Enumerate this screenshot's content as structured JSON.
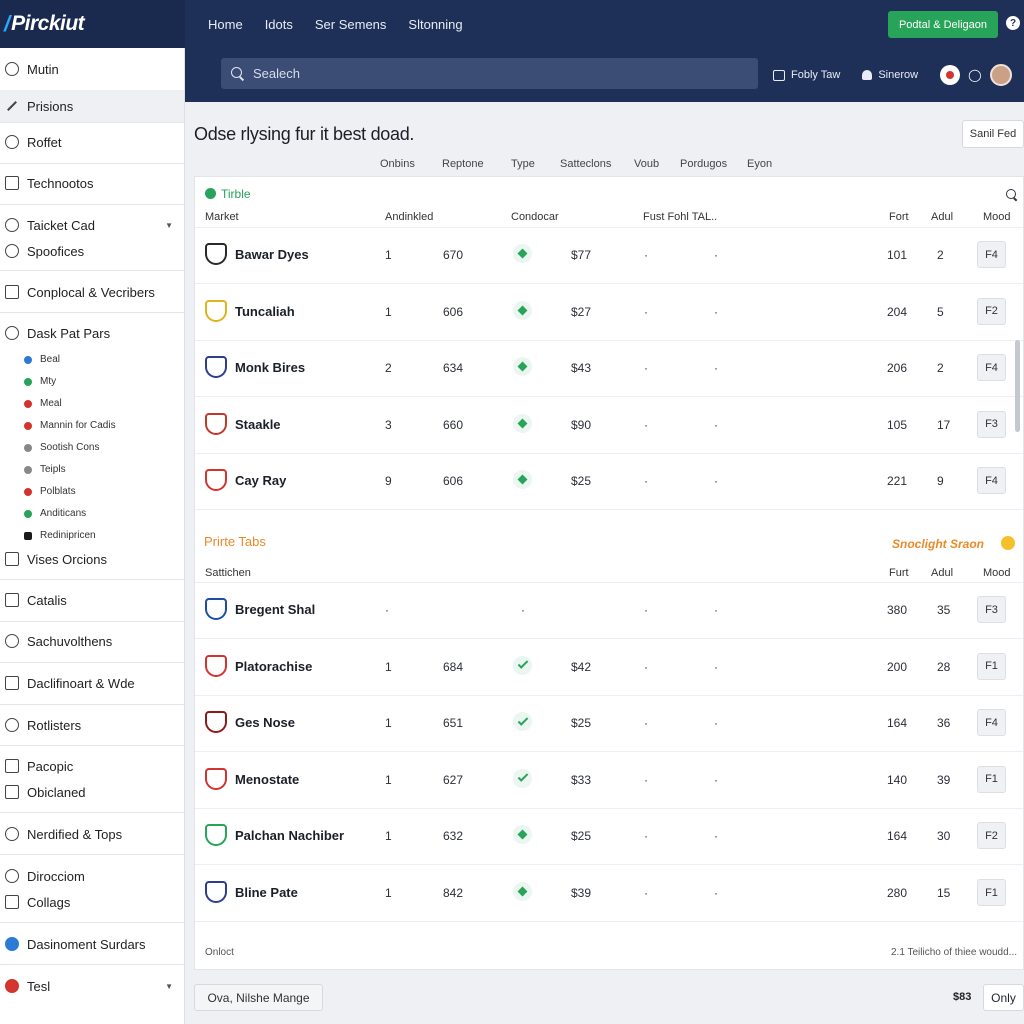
{
  "app": {
    "logo_mark": "/",
    "logo_text": "Pirckiut"
  },
  "topnav": [
    "Home",
    "Idots",
    "Ser Semens",
    "Sltonning"
  ],
  "cta_label": "Podtal & Deligaon",
  "help_glyph": "?",
  "search": {
    "placeholder": "Sealech"
  },
  "subbar": {
    "link1": "Fobly Taw",
    "link2": "Sinerow"
  },
  "sidebar": {
    "items": [
      "Mutin",
      "Prisions",
      "Roffet",
      "Technootos",
      "Taicket Cad",
      "Spoofices",
      "Conplocal & Vecribers",
      "Dask Pat Pars",
      "Vises Orcions",
      "Catalis",
      "Sachuvolthens",
      "Daclifinoart & Wde",
      "Rotlisters",
      "Pacopic",
      "Obiclaned",
      "Nerdified & Tops",
      "Dirocciom",
      "Collags",
      "Dasinoment Surdars",
      "Tesl"
    ],
    "subitems": [
      "Beal",
      "Mty",
      "Meal",
      "Mannin for Cadis",
      "Sootish Cons",
      "Teipls",
      "Polblats",
      "Anditicans",
      "Redinipricen"
    ],
    "sub_colors": [
      "#2a7bd6",
      "#27a35a",
      "#d2342f",
      "#d2342f",
      "#888888",
      "#888888",
      "#d2342f",
      "#27a35a",
      "#1a1a1a"
    ]
  },
  "main": {
    "title": "Odse rlysing fur it best doad.",
    "sort_label": "Sanil Fed",
    "filters": [
      "Onbins",
      "Reptone",
      "Type",
      "Satteclons",
      "Voub",
      "Pordugos",
      "Eyon"
    ]
  },
  "section1": {
    "title": "Tirble",
    "columns": [
      "Market",
      "Andinkled",
      "Condocar",
      "Fust Fohl TAL..",
      "Fort",
      "Adul",
      "Mood"
    ],
    "rows": [
      {
        "name": "Bawar Dyes",
        "a": "1",
        "b": "670",
        "status": "diamond",
        "price": "$77",
        "d1": "·",
        "d2": "·",
        "fort": "101",
        "adul": "2",
        "mood": "F4",
        "logo": "#2a2a2a"
      },
      {
        "name": "Tuncaliah",
        "a": "1",
        "b": "606",
        "status": "diamond",
        "price": "$27",
        "d1": "·",
        "d2": "·",
        "fort": "204",
        "adul": "5",
        "mood": "F2",
        "logo": "#e0b41e"
      },
      {
        "name": "Monk Bires",
        "a": "2",
        "b": "634",
        "status": "diamond",
        "price": "$43",
        "d1": "·",
        "d2": "·",
        "fort": "206",
        "adul": "2",
        "mood": "F4",
        "logo": "#2d3e8c"
      },
      {
        "name": "Staakle",
        "a": "3",
        "b": "660",
        "status": "diamond",
        "price": "$90",
        "d1": "·",
        "d2": "·",
        "fort": "105",
        "adul": "17",
        "mood": "F3",
        "logo": "#c0392b"
      },
      {
        "name": "Cay Ray",
        "a": "9",
        "b": "606",
        "status": "diamond",
        "price": "$25",
        "d1": "·",
        "d2": "·",
        "fort": "221",
        "adul": "9",
        "mood": "F4",
        "logo": "#d2342f"
      }
    ]
  },
  "section2": {
    "title": "Prirte Tabs",
    "spotlight": "Snoclight Sraon",
    "columns": [
      "Sattichen",
      "Furt",
      "Adul",
      "Mood"
    ],
    "rows": [
      {
        "name": "Bregent Shal",
        "a": "·",
        "b": "",
        "status": "none",
        "mid": "·",
        "price": "",
        "d1": "·",
        "d2": "·",
        "fort": "380",
        "adul": "35",
        "mood": "F3",
        "logo": "#1f4fa3"
      },
      {
        "name": "Platorachise",
        "a": "1",
        "b": "684",
        "status": "check",
        "price": "$42",
        "d1": "·",
        "d2": "·",
        "fort": "200",
        "adul": "28",
        "mood": "F1",
        "logo": "#d2342f"
      },
      {
        "name": "Ges Nose",
        "a": "1",
        "b": "651",
        "status": "check",
        "price": "$25",
        "d1": "·",
        "d2": "·",
        "fort": "164",
        "adul": "36",
        "mood": "F4",
        "logo": "#8e1b1b"
      },
      {
        "name": "Menostate",
        "a": "1",
        "b": "627",
        "status": "check",
        "price": "$33",
        "d1": "·",
        "d2": "·",
        "fort": "140",
        "adul": "39",
        "mood": "F1",
        "logo": "#d2342f"
      },
      {
        "name": "Palchan Nachiber",
        "a": "1",
        "b": "632",
        "status": "diamond",
        "price": "$25",
        "d1": "·",
        "d2": "·",
        "fort": "164",
        "adul": "30",
        "mood": "F2",
        "logo": "#27a35a"
      },
      {
        "name": "Bline Pate",
        "a": "1",
        "b": "842",
        "status": "diamond",
        "price": "$39",
        "d1": "·",
        "d2": "·",
        "fort": "280",
        "adul": "15",
        "mood": "F1",
        "logo": "#2d3e8c"
      }
    ]
  },
  "footer": {
    "left": "Onloct",
    "right": "2.1 Teilicho of thiee woudd..."
  },
  "bottom": {
    "button": "Ova, Nilshe Mange",
    "price": "$83",
    "only": "Only"
  }
}
